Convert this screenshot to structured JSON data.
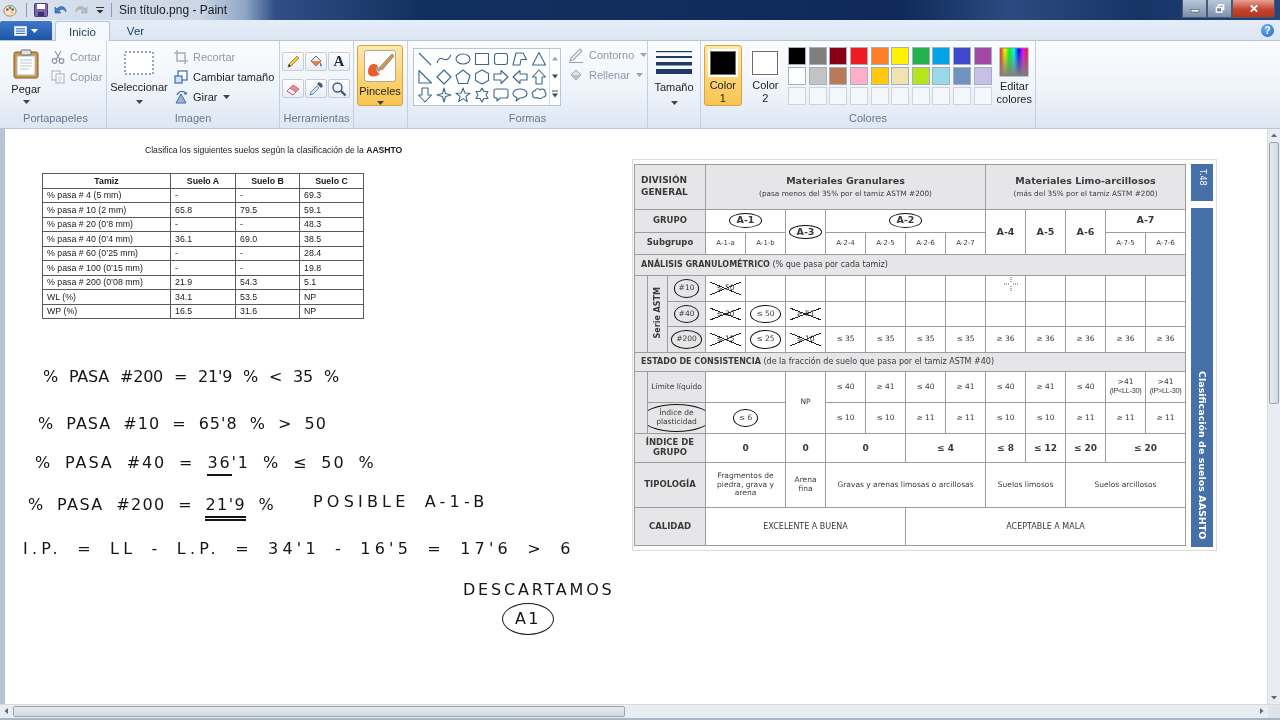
{
  "window": {
    "title": "Sin título.png - Paint"
  },
  "tabs": [
    {
      "label": "Inicio",
      "selected": true
    },
    {
      "label": "Ver",
      "selected": false
    }
  ],
  "ribbon": {
    "help": "?",
    "clipboard": {
      "label": "Portapapeles",
      "paste": "Pegar",
      "items": [
        {
          "label": "Cortar",
          "disabled": true
        },
        {
          "label": "Copiar",
          "disabled": true
        }
      ]
    },
    "image": {
      "label": "Imagen",
      "select": "Seleccionar",
      "items": [
        {
          "label": "Recortar",
          "disabled": true,
          "dropdown": false
        },
        {
          "label": "Cambiar tamaño",
          "disabled": false,
          "dropdown": false
        },
        {
          "label": "Girar",
          "disabled": false,
          "dropdown": true
        }
      ]
    },
    "tools": {
      "label": "Herramientas",
      "text_tool": "A"
    },
    "brushes": {
      "label": "Pinceles",
      "selected": true
    },
    "shapes": {
      "label": "Formas",
      "items": [
        {
          "label": "Contorno",
          "disabled": true,
          "dropdown": true
        },
        {
          "label": "Rellenar",
          "disabled": true,
          "dropdown": true
        }
      ]
    },
    "size": {
      "label": "Tamaño"
    },
    "colors": {
      "label": "Colores",
      "slots": [
        {
          "label": "Color 1",
          "color": "#000000",
          "selected": true
        },
        {
          "label": "Color 2",
          "color": "#ffffff",
          "selected": false
        }
      ],
      "palette": [
        {
          "color": "#000000"
        },
        {
          "color": "#7f7f7f"
        },
        {
          "color": "#880015"
        },
        {
          "color": "#ed1c24"
        },
        {
          "color": "#ff7f27"
        },
        {
          "color": "#fff200"
        },
        {
          "color": "#22b14c"
        },
        {
          "color": "#00a2e8"
        },
        {
          "color": "#3f48cc"
        },
        {
          "color": "#a349a4"
        },
        {
          "color": "#ffffff"
        },
        {
          "color": "#c3c3c3"
        },
        {
          "color": "#b97a57"
        },
        {
          "color": "#ffaec9"
        },
        {
          "color": "#ffc90e"
        },
        {
          "color": "#efe4b0"
        },
        {
          "color": "#b5e61d"
        },
        {
          "color": "#99d9ea"
        },
        {
          "color": "#7092be"
        },
        {
          "color": "#c8bfe7"
        }
      ],
      "edit": "Editar colores"
    }
  },
  "document": {
    "instruction": "Clasifica los siguientes suelos según la clasificación de la **AASHTO**",
    "soil_table": {
      "columns": [
        "Tamiz",
        "Suelo A",
        "Suelo B",
        "Suelo C"
      ],
      "rows": [
        [
          "% pasa # 4 (5 mm)",
          "-",
          "-",
          "69.3"
        ],
        [
          "% pasa # 10 (2 mm)",
          "65.8",
          "79.5",
          "59.1"
        ],
        [
          "% pasa # 20 (0’8 mm)",
          "-",
          "-",
          "48.3"
        ],
        [
          "% pasa # 40 (0’4 mm)",
          "36.1",
          "69.0",
          "38.5"
        ],
        [
          "% pasa # 60 (0’25 mm)",
          "-",
          "-",
          "28.4"
        ],
        [
          "% pasa # 100 (0’15 mm)",
          "-",
          "-",
          "19.8"
        ],
        [
          "% pasa # 200 (0’08 mm)",
          "21.9",
          "54.3",
          "5.1"
        ],
        [
          "WL (%)",
          "34.1",
          "53.5",
          "NP"
        ],
        [
          "WP (%)",
          "16.5",
          "31.6",
          "NP"
        ]
      ]
    },
    "notes": [
      {
        "text": "% PASA #200 = 21'9 % < 35 %",
        "circled": false
      },
      {
        "text": "% PASA #10 = 65'8 % > 50",
        "circled": false
      },
      {
        "text": "% PASA #40 = ",
        "underlined": "36",
        "double": false,
        "rest": "'1 % ≤ 50 %",
        "circled": false
      },
      {
        "text": "% PASA #200 = ",
        "underlined": "21'9",
        "double": true,
        "rest": " %",
        "circled": false
      },
      {
        "text": "POSIBLE A-1-B",
        "circled": false
      },
      {
        "text": "I.P. = LL - L.P. = 34'1 - 16'5 = 17'6 > 6",
        "circled": false
      },
      {
        "text": "DESCARTAMOS",
        "circled": false
      },
      {
        "text": "A1",
        "circled": true
      }
    ],
    "classification_table": {
      "division_label": "DIVISIÓN GENERAL",
      "divisions": [
        {
          "title": "Materiales Granulares",
          "note": "(pasa menos del 35% por el tamiz ASTM #200)"
        },
        {
          "title": "Materiales Limo-arcillosos",
          "note": "(más del 35% por el tamiz ASTM #200)"
        }
      ],
      "group_label": "GRUPO",
      "groups": [
        {
          "label": "A-1",
          "circled": true
        },
        {
          "label": "A-3",
          "circled": true
        },
        {
          "label": "A-2",
          "circled": true
        },
        {
          "label": "A-4",
          "circled": false
        },
        {
          "label": "A-5",
          "circled": false
        },
        {
          "label": "A-6",
          "circled": false
        },
        {
          "label": "A-7",
          "circled": false
        }
      ],
      "subgroup_label": "Subgrupo",
      "subgroups": [
        "A-1-a",
        "A-1-b",
        "A-2-4",
        "A-2-5",
        "A-2-6",
        "A-2-7",
        "A-7-5",
        "A-7-6"
      ],
      "grading_heading": "**ANÁLISIS GRANULOMÉTRICO** (% que pasa por cada tamiz)",
      "sieve_series": "Serie ASTM",
      "sieves": [
        {
          "label": "#10",
          "circled": true,
          "cells": [
            {
              "text": "≤ 50",
              "circled": false,
              "crossed": true
            },
            null,
            null,
            null,
            null,
            null,
            null,
            null,
            null,
            null,
            null,
            null
          ]
        },
        {
          "label": "#40",
          "circled": true,
          "cells": [
            {
              "text": "≤ 30",
              "circled": false,
              "crossed": true
            },
            {
              "text": "≤ 50",
              "circled": true,
              "crossed": false
            },
            {
              "text": "≥ 51",
              "circled": false,
              "crossed": true
            },
            null,
            null,
            null,
            null,
            null,
            null,
            null,
            null,
            null
          ]
        },
        {
          "label": "#200",
          "circled": true,
          "cells": [
            {
              "text": "≤ 15",
              "circled": false,
              "crossed": true
            },
            {
              "text": "≤ 25",
              "circled": true,
              "crossed": false
            },
            {
              "text": "≤ 10",
              "circled": false,
              "crossed": true
            },
            {
              "text": "≤ 35",
              "circled": false,
              "crossed": false
            },
            {
              "text": "≤ 35",
              "circled": false,
              "crossed": false
            },
            {
              "text": "≤ 35",
              "circled": false,
              "crossed": false
            },
            {
              "text": "≤ 35",
              "circled": false,
              "crossed": false
            },
            {
              "text": "≥ 36",
              "circled": false,
              "crossed": false
            },
            {
              "text": "≥ 36",
              "circled": false,
              "crossed": false
            },
            {
              "text": "≥ 36",
              "circled": false,
              "crossed": false
            },
            {
              "text": "≥ 36",
              "circled": false,
              "crossed": false
            },
            {
              "text": "≥ 36",
              "circled": false,
              "crossed": false
            }
          ]
        }
      ],
      "consistency_heading": "**ESTADO DE CONSISTENCIA** (de la fracción de suelo que pasa por el tamiz ASTM #40)",
      "consistency_rows": [
        {
          "label": "Límite líquido",
          "circled": false,
          "cells": [
            null,
            {
              "text": "≤ 40",
              "circled": false
            },
            {
              "text": "≥ 41",
              "circled": false
            },
            {
              "text": "≤ 40",
              "circled": false
            },
            {
              "text": "≥ 41",
              "circled": false
            },
            {
              "text": "≤ 40",
              "circled": false
            },
            {
              "text": "≥ 41",
              "circled": false
            },
            {
              "text": "≤ 40",
              "circled": false
            },
            {
              "text": ">41",
              "note": "(IP<LL-30)",
              "circled": false
            },
            {
              "text": ">41",
              "note": "(IP>LL-30)",
              "circled": false
            }
          ]
        },
        {
          "label": "Índice de plasticidad",
          "circled": true,
          "cells": [
            {
              "text": "≤ 6",
              "circled": true
            },
            {
              "text": "≤ 10",
              "circled": false
            },
            {
              "text": "≤ 10",
              "circled": false
            },
            {
              "text": "≥ 11",
              "circled": false
            },
            {
              "text": "≥ 11",
              "circled": false
            },
            {
              "text": "≤ 10",
              "circled": false
            },
            {
              "text": "≤ 10",
              "circled": false
            },
            {
              "text": "≥ 11",
              "circled": false
            },
            {
              "text": "≥ 11",
              "circled": false
            },
            {
              "text": "≥ 11",
              "circled": false
            }
          ]
        }
      ],
      "non_plastic": "NP",
      "group_index": {
        "label": "ÍNDICE DE GRUPO",
        "values": [
          "0",
          "0",
          "0",
          "≤ 4",
          "≤ 8",
          "≤ 12",
          "≤ 20",
          "≤ 20"
        ]
      },
      "typology": {
        "label": "TIPOLOGÍA",
        "values": [
          "Fragmentos de piedra, grava y arena",
          "Arena fina",
          "Gravas y arenas limosas o arcillosas",
          "Suelos limosos",
          "Suelos arcillosos"
        ]
      },
      "quality": {
        "label": "CALIDAD",
        "values": [
          "EXCELENTE A BUENA",
          "ACEPTABLE A MALA"
        ]
      },
      "side_tab": "T.48",
      "side_title": "Clasificación de suelos AASHTO"
    }
  }
}
